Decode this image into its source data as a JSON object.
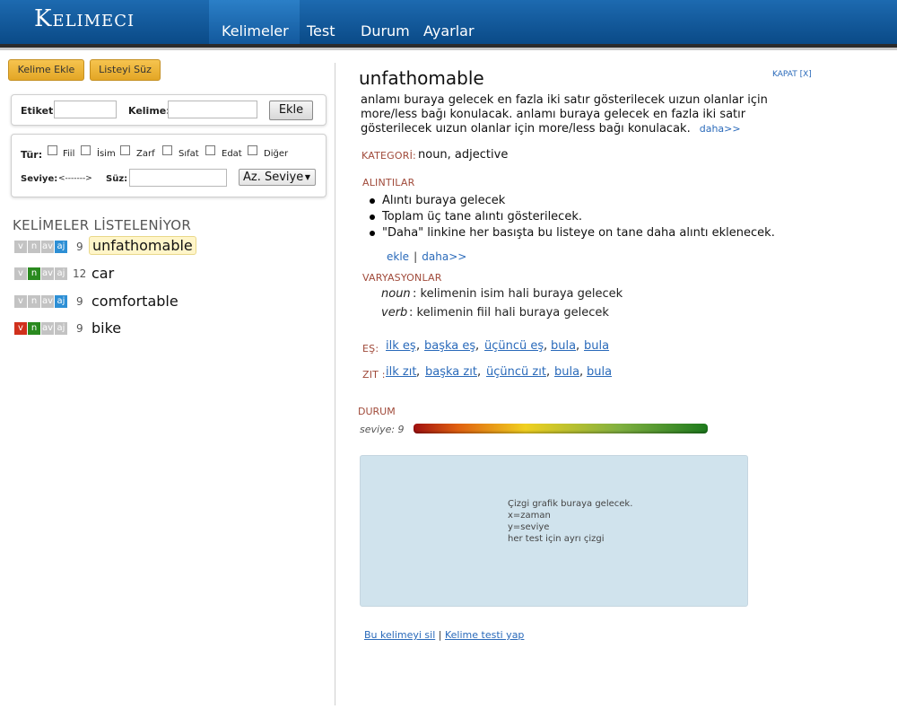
{
  "app": {
    "logo": "Kelimeci"
  },
  "nav": [
    "Kelimeler",
    "Test",
    "Durum",
    "Ayarlar"
  ],
  "actions": {
    "add_word": "Kelime Ekle",
    "filter_list": "Listeyi Süz"
  },
  "add_form": {
    "tag_label": "Etiket:",
    "word_label": "Kelime:",
    "add_button": "Ekle",
    "tag_value": "",
    "word_value": ""
  },
  "filter_form": {
    "type_label": "Tür:",
    "types": [
      "Fiil",
      "İsim",
      "Zarf",
      "Sıfat",
      "Edat",
      "Diğer"
    ],
    "level_label": "Seviye:",
    "level_slider": "<------->",
    "filter_label": "Süz:",
    "filter_value": "",
    "sort_selected": "Az. Seviye"
  },
  "list": {
    "title": "KELİMELER LİSTELENİYOR",
    "badge_labels": [
      "v",
      "n",
      "av",
      "aj"
    ],
    "words": [
      {
        "word": "unfathomable",
        "level": "9",
        "badges": [
          "off",
          "off",
          "off",
          "on"
        ],
        "selected": true
      },
      {
        "word": "car",
        "level": "12",
        "badges": [
          "off",
          "on",
          "off",
          "off"
        ],
        "selected": false
      },
      {
        "word": "comfortable",
        "level": "9",
        "badges": [
          "off",
          "off",
          "off",
          "on"
        ],
        "selected": false
      },
      {
        "word": "bike",
        "level": "9",
        "badges": [
          "on",
          "on",
          "off",
          "off"
        ],
        "selected": false
      }
    ],
    "badge_colors": {
      "v": "#d0301c",
      "n": "#2a8a1f",
      "av": "#3d88cc",
      "aj": "#2d8fd5",
      "off": "#c3c3c3"
    }
  },
  "detail": {
    "title": "unfathomable",
    "close": "KAPAT [X]",
    "meaning": "anlamı buraya gelecek en fazla iki satır gösterilecek uızun olanlar için more/less bağı konulacak. anlamı buraya gelecek en fazla iki satır gösterilecek uızun olanlar için more/less bağı konulacak.",
    "meaning_more": "daha>>",
    "category_label": "KATEGORİ:",
    "category_value": "noun, adjective",
    "quotes_label": "ALINTILAR",
    "quotes": [
      "Alıntı buraya gelecek",
      "Toplam üç tane alıntı gösterilecek.",
      "\"Daha\" linkine her basışta bu listeye on tane daha alıntı eklenecek."
    ],
    "quote_add": "ekle",
    "quote_sep": "|",
    "quote_more": "daha>>",
    "variations_label": "VARYASYONLAR",
    "variations": [
      {
        "pos": "noun",
        "text": ": kelimenin isim hali buraya gelecek"
      },
      {
        "pos": "verb",
        "text": ": kelimenin fiil hali buraya gelecek"
      }
    ],
    "synonyms_label": "EŞ:",
    "synonyms": [
      "ilk eş",
      "başka eş",
      "üçüncü eş",
      "bula",
      "bula"
    ],
    "antonyms_label": "ZIT :",
    "antonyms": [
      "ilk zıt",
      "başka zıt",
      "üçüncü zıt",
      "bula",
      "bula"
    ],
    "status_label": "DURUM",
    "level_text": "seviye: 9",
    "graph_lines": [
      "Çizgi grafik buraya gelecek.",
      "x=zaman",
      "y=seviye",
      "her test için ayrı çizgi"
    ],
    "delete_link": "Bu kelimeyi sil",
    "link_sep": "|",
    "test_link": "Kelime testi yap"
  }
}
